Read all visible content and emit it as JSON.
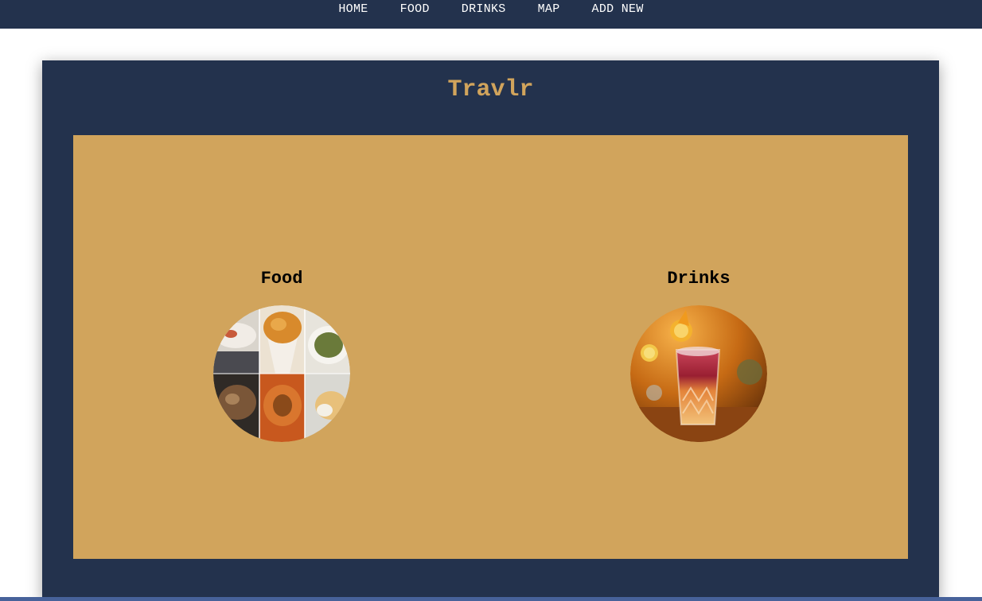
{
  "nav": {
    "items": [
      {
        "label": "HOME"
      },
      {
        "label": "FOOD"
      },
      {
        "label": "DRINKS"
      },
      {
        "label": "MAP"
      },
      {
        "label": "ADD NEW"
      }
    ]
  },
  "site": {
    "title": "Travlr"
  },
  "categories": [
    {
      "label": "Food",
      "image": "food-collage"
    },
    {
      "label": "Drinks",
      "image": "cocktail-glass"
    }
  ],
  "colors": {
    "nav_bg": "#23324d",
    "title": "#d1a45c",
    "panel": "#d1a45c"
  }
}
